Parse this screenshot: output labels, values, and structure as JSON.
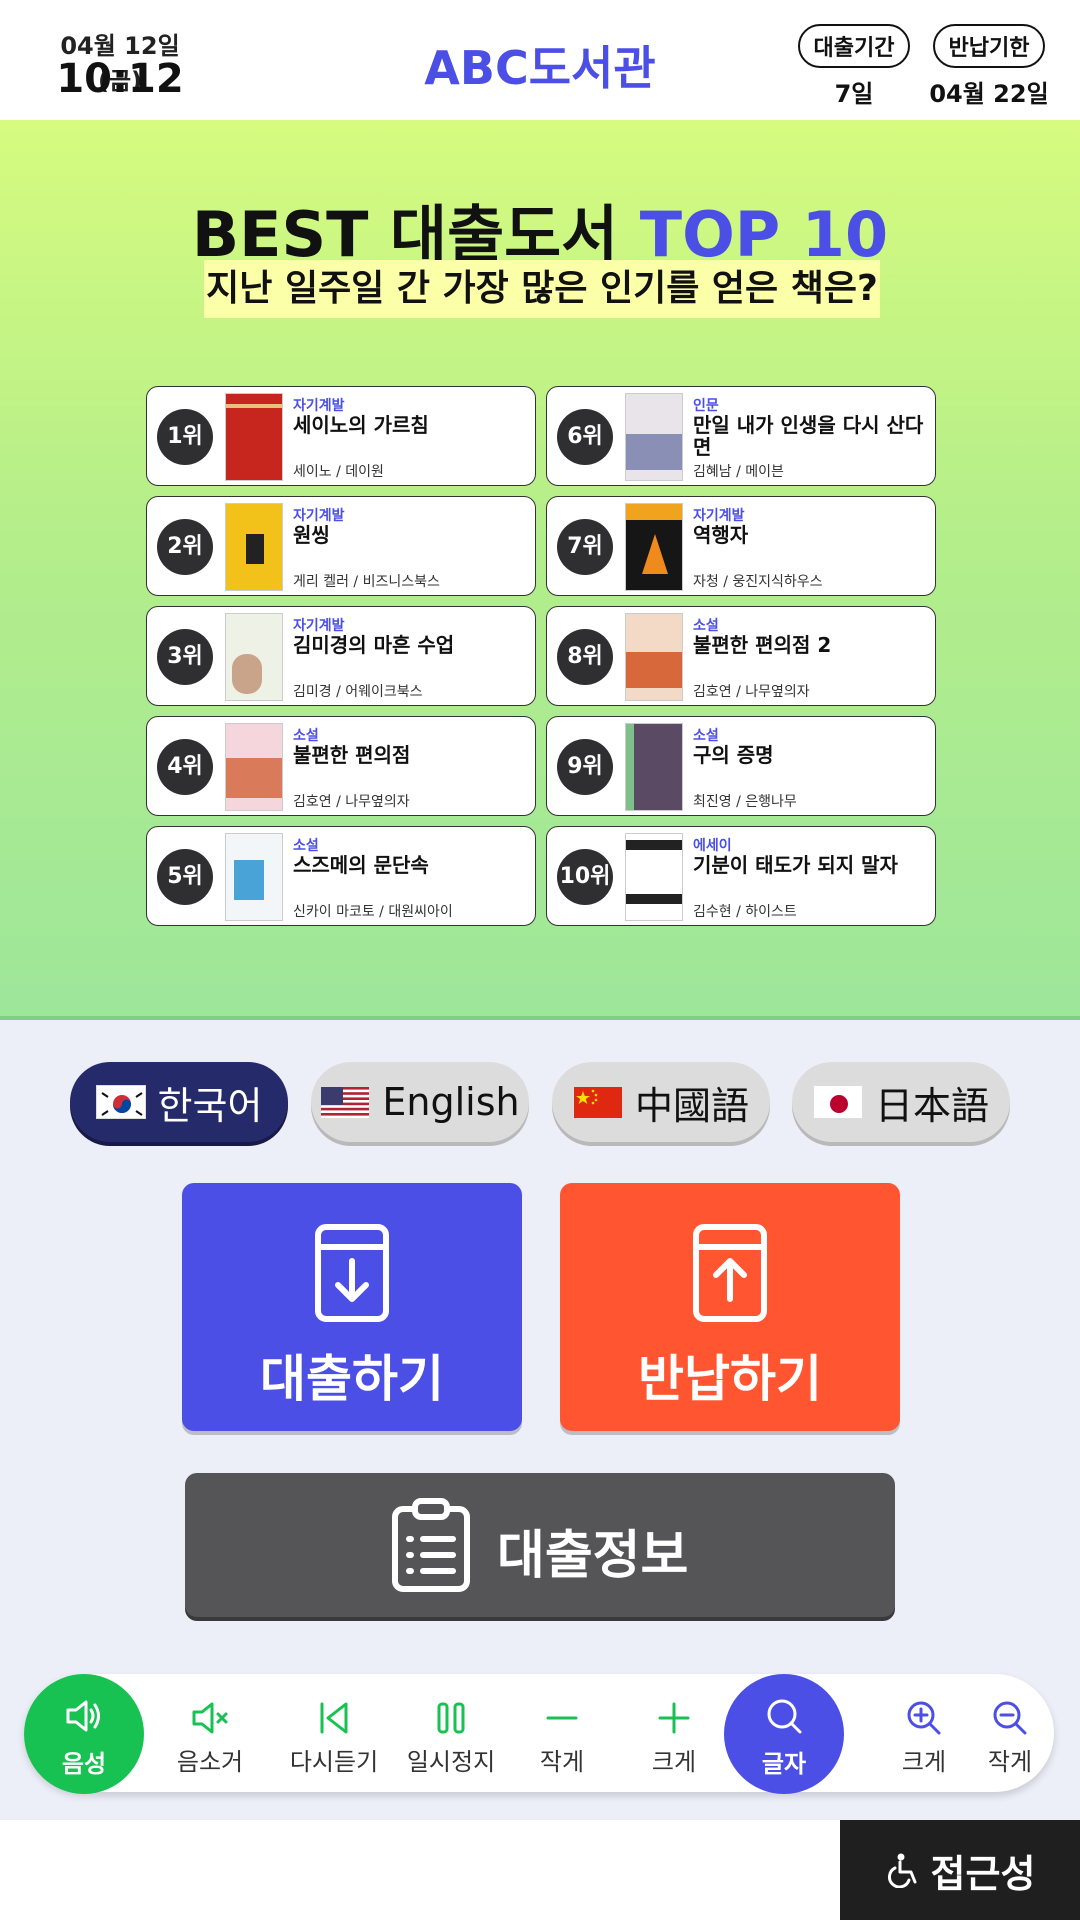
{
  "header": {
    "date": "04월 12일 (금)",
    "time": "10:12",
    "library_name": "ABC도서관",
    "loan_period_label": "대출기간",
    "loan_period_value": "7일",
    "return_due_label": "반납기한",
    "return_due_value": "04월 22일"
  },
  "hero": {
    "title_main": "BEST 대출도서 ",
    "title_accent": "TOP 10",
    "subtitle": "지난 일주일 간 가장 많은 인기를 얻은 책은?"
  },
  "books": [
    {
      "rank": "1위",
      "category": "자기계발",
      "title": "세이노의 가르침",
      "author": "세이노 / 데이원"
    },
    {
      "rank": "2위",
      "category": "자기계발",
      "title": "원씽",
      "author": "게리 켈러 / 비즈니스북스"
    },
    {
      "rank": "3위",
      "category": "자기계발",
      "title": "김미경의 마흔 수업",
      "author": "김미경 / 어웨이크북스"
    },
    {
      "rank": "4위",
      "category": "소설",
      "title": "불편한 편의점",
      "author": "김호연 / 나무옆의자"
    },
    {
      "rank": "5위",
      "category": "소설",
      "title": "스즈메의 문단속",
      "author": "신카이 마코토 / 대원씨아이"
    },
    {
      "rank": "6위",
      "category": "인문",
      "title": "만일 내가 인생을 다시 산다면",
      "author": "김혜남 / 메이븐"
    },
    {
      "rank": "7위",
      "category": "자기계발",
      "title": "역행자",
      "author": "자청 / 웅진지식하우스"
    },
    {
      "rank": "8위",
      "category": "소설",
      "title": "불편한 편의점 2",
      "author": "김호연 / 나무옆의자"
    },
    {
      "rank": "9위",
      "category": "소설",
      "title": "구의 증명",
      "author": "최진영 / 은행나무"
    },
    {
      "rank": "10위",
      "category": "에세이",
      "title": "기분이 태도가 되지 말자",
      "author": "김수현 / 하이스트"
    }
  ],
  "languages": [
    {
      "label": "한국어",
      "flag": "korea-flag-icon",
      "active": true
    },
    {
      "label": "English",
      "flag": "usa-flag-icon",
      "active": false
    },
    {
      "label": "中國語",
      "flag": "china-flag-icon",
      "active": false
    },
    {
      "label": "日本語",
      "flag": "japan-flag-icon",
      "active": false
    }
  ],
  "actions": {
    "borrow": "대출하기",
    "return": "반납하기",
    "loan_info": "대출정보"
  },
  "accessibility": {
    "voice": "음성",
    "mute": "음소거",
    "replay": "다시듣기",
    "pause": "일시정지",
    "vol_down": "작게",
    "vol_up": "크게",
    "text": "글자",
    "zoom_in": "크게",
    "zoom_out": "작게",
    "tab": "접근성"
  },
  "colors": {
    "brand": "#4b4fe6",
    "borrow": "#4b4fe6",
    "return": "#ff5530",
    "info": "#555558",
    "voice": "#17c253",
    "active_lang": "#252a6b"
  }
}
